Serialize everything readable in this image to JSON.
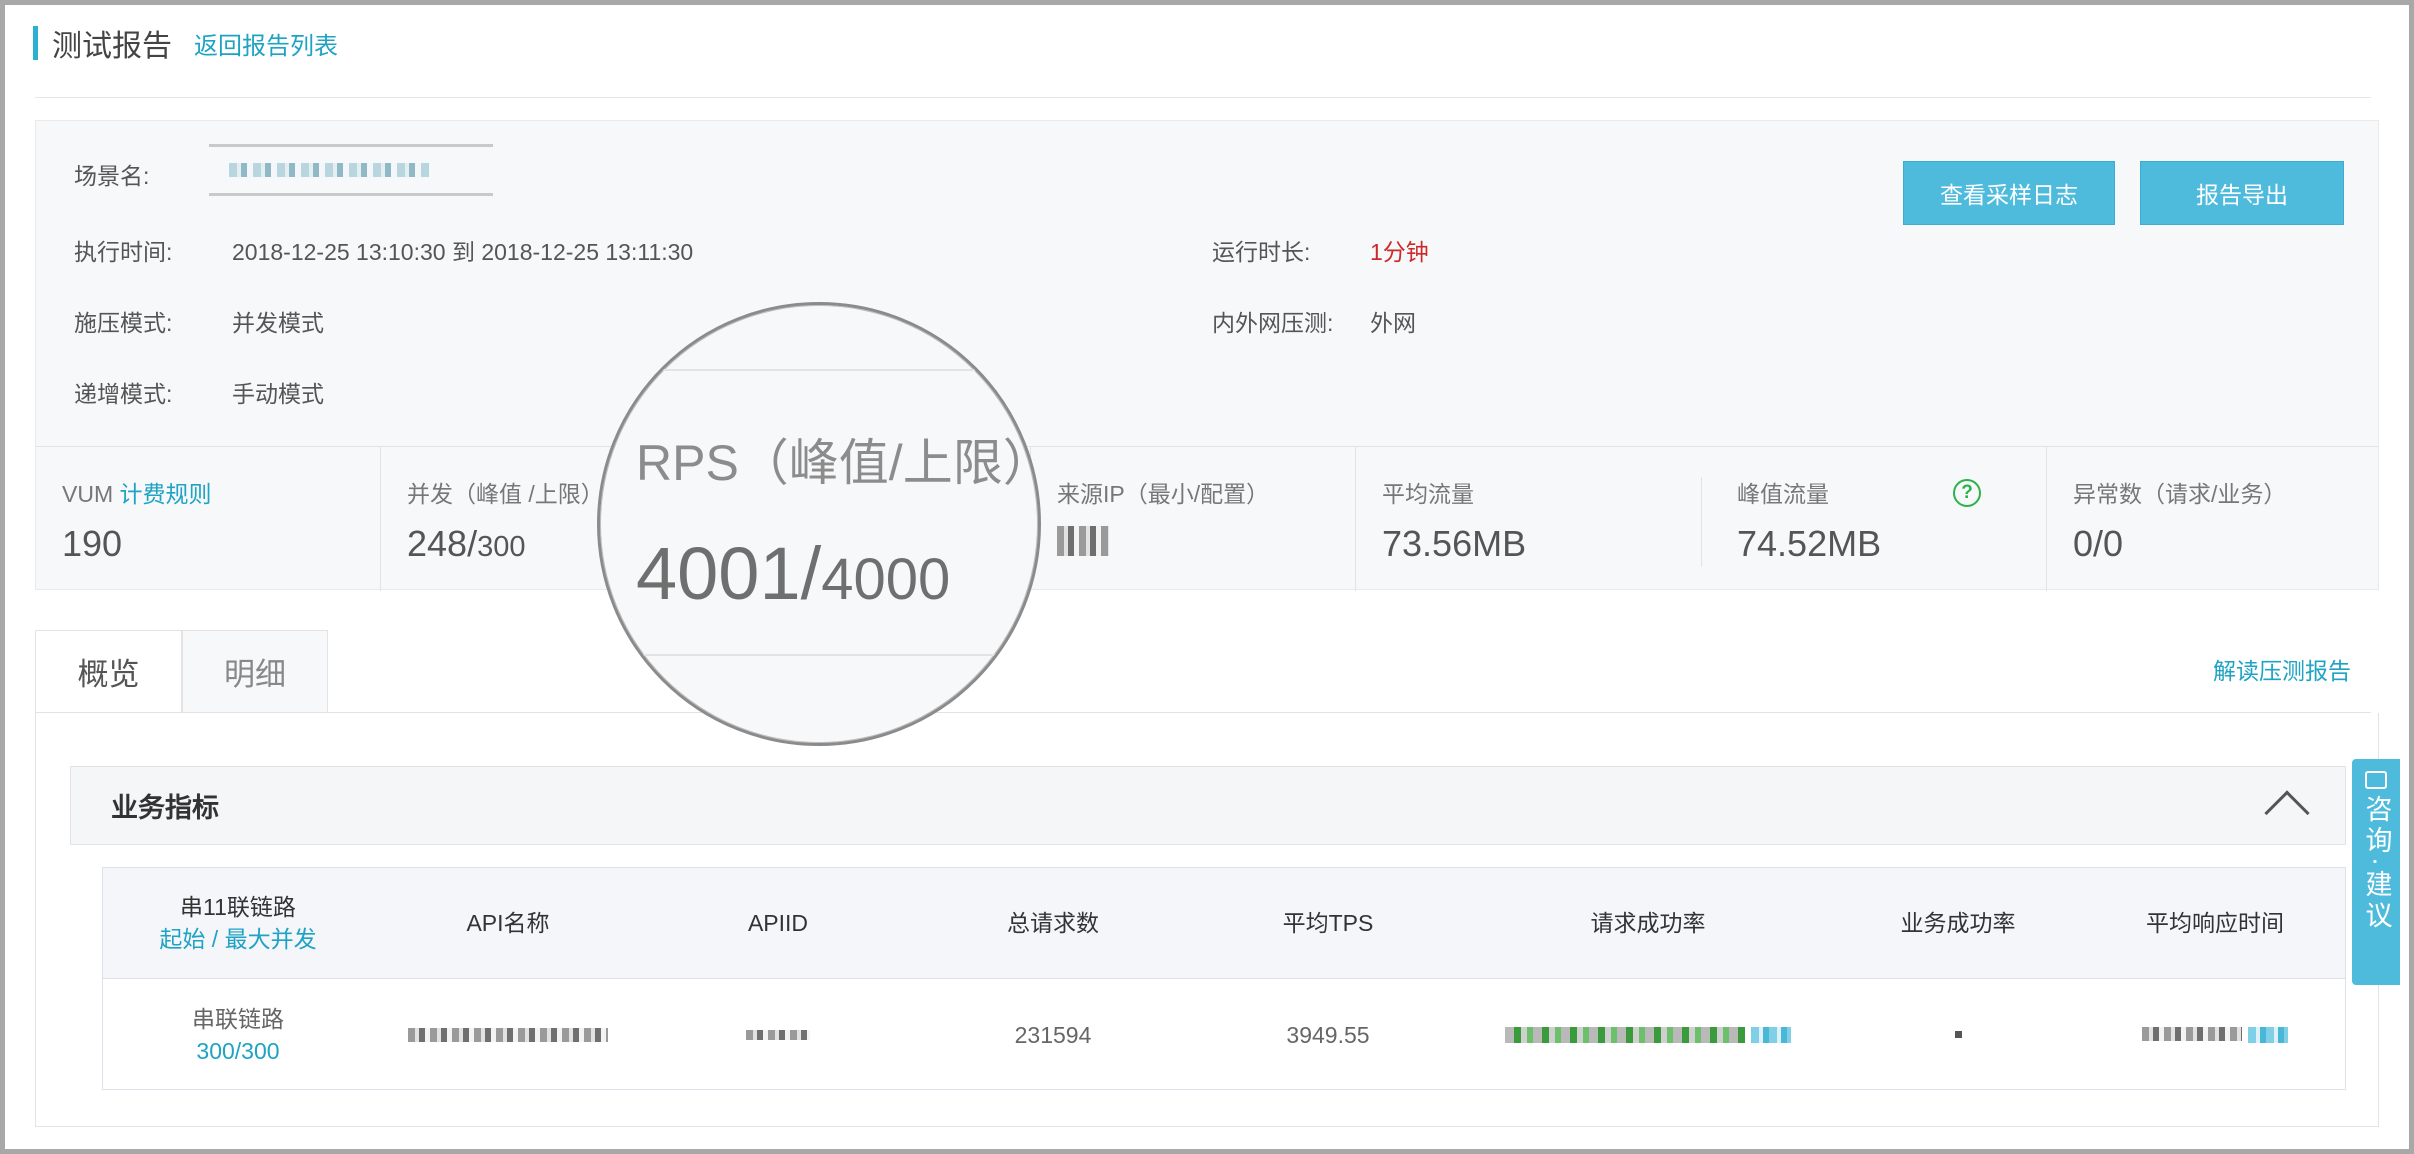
{
  "header": {
    "title": "测试报告",
    "back_link": "返回报告列表"
  },
  "summary": {
    "scene_label": "场景名:",
    "exec_time_label": "执行时间:",
    "exec_time_value": "2018-12-25 13:10:30 到 2018-12-25 13:11:30",
    "duration_label": "运行时长:",
    "duration_value": "1分钟",
    "pressure_mode_label": "施压模式:",
    "pressure_mode_value": "并发模式",
    "network_label": "内外网压测:",
    "network_value": "外网",
    "increment_label": "递增模式:",
    "increment_value": "手动模式",
    "view_log_button": "查看采样日志",
    "export_button": "报告导出"
  },
  "metrics": {
    "vum_label": "VUM",
    "vum_link": "计费规则",
    "vum_value": "190",
    "concurrency_label": "并发（峰值 /上限）",
    "concurrency_peak": "248/",
    "concurrency_limit": "300",
    "source_ip_label": "来源IP（最小/配置）",
    "avg_traffic_label": "平均流量",
    "avg_traffic_value": "73.56MB",
    "peak_traffic_label": "峰值流量",
    "peak_traffic_value": "74.52MB",
    "exceptions_label": "异常数（请求/业务）",
    "exceptions_value": "0/0"
  },
  "magnifier": {
    "label": "RPS（峰值/上限）",
    "peak": "4001/",
    "limit": "4000"
  },
  "tabs": [
    {
      "label": "概览"
    },
    {
      "label": "明细"
    }
  ],
  "read_report_link": "解读压测报告",
  "section": {
    "title": "业务指标"
  },
  "table": {
    "headers": {
      "chain": "串11联链路",
      "chain_sub": "起始 / 最大并发",
      "api_name": "API名称",
      "api_id": "APIID",
      "total_requests": "总请求数",
      "avg_tps": "平均TPS",
      "request_success": "请求成功率",
      "business_success": "业务成功率",
      "avg_response": "平均响应时间"
    },
    "row": {
      "chain": "串联链路",
      "chain_sub": "300/300",
      "total_requests": "231594",
      "avg_tps": "3949.55"
    }
  },
  "consult": {
    "label": "咨询·建议"
  }
}
